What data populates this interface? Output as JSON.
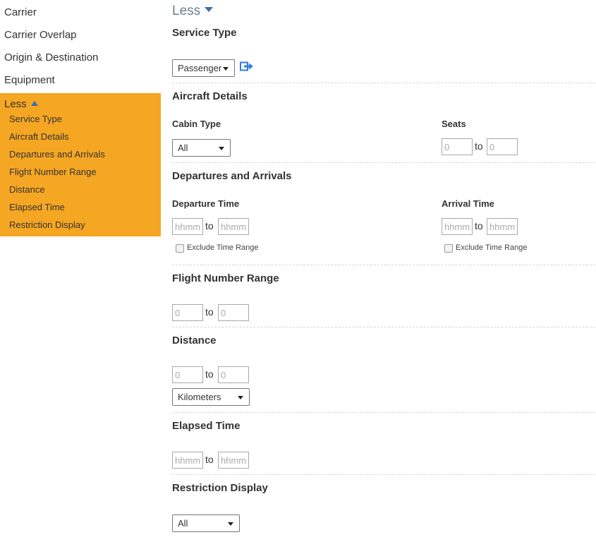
{
  "sidebar": {
    "links": [
      "Carrier",
      "Carrier Overlap",
      "Origin & Destination",
      "Equipment"
    ],
    "less_label": "Less",
    "sub_items": [
      "Service Type",
      "Aircraft Details",
      "Departures and Arrivals",
      "Flight Number Range",
      "Distance",
      "Elapsed Time",
      "Restriction Display"
    ],
    "panel_color": "#f5a623"
  },
  "main": {
    "less_label": "Less",
    "service_type": {
      "title": "Service Type",
      "select_value": "Passenger",
      "icon": "export-icon"
    },
    "aircraft_details": {
      "title": "Aircraft Details",
      "cabin_type_label": "Cabin Type",
      "cabin_type_value": "All",
      "seats_label": "Seats",
      "seats_from_placeholder": "0",
      "seats_to_placeholder": "0",
      "to_text": "to"
    },
    "departures_arrivals": {
      "title": "Departures and Arrivals",
      "departure_label": "Departure Time",
      "arrival_label": "Arrival Time",
      "time_placeholder": "hhmm",
      "to_text": "to",
      "exclude_label": "Exclude Time Range"
    },
    "flight_number_range": {
      "title": "Flight Number Range",
      "from_placeholder": "0",
      "to_placeholder": "0",
      "to_text": "to"
    },
    "distance": {
      "title": "Distance",
      "from_placeholder": "0",
      "to_placeholder": "0",
      "to_text": "to",
      "unit_value": "Kilometers"
    },
    "elapsed_time": {
      "title": "Elapsed Time",
      "from_placeholder": "hhmm",
      "to_placeholder": "hhmm",
      "to_text": "to"
    },
    "restriction_display": {
      "title": "Restriction Display",
      "select_value": "All"
    }
  },
  "colors": {
    "accent_blue": "#3b6db4",
    "icon_blue": "#2f7de1"
  }
}
